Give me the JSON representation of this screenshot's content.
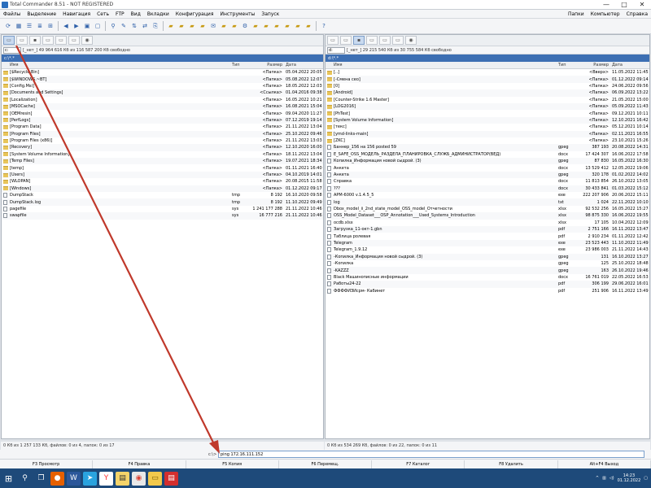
{
  "window": {
    "title": "Total Commander 8.51 - NOT REGISTERED",
    "controls": [
      "—",
      "□",
      "✕"
    ]
  },
  "menu": {
    "items": [
      "Файлы",
      "Выделение",
      "Навигация",
      "Сеть",
      "FTP",
      "Вид",
      "Вкладки",
      "Конфигурация",
      "Инструменты",
      "Запуск"
    ],
    "right": [
      "Папки",
      "Компьютер",
      "Справка"
    ]
  },
  "toolbar": {
    "icons": [
      "refresh-icon",
      "thumbnails-icon",
      "brief-icon",
      "full-icon",
      "tree-icon",
      "back-icon",
      "forward-icon",
      "pack-icon",
      "unpack-icon",
      "search-icon",
      "rename-icon",
      "ftp-icon",
      "sync-icon",
      "copy-names-icon",
      "folder-icon",
      "folder-icon",
      "folder-icon",
      "folder-icon",
      "notepad-icon",
      "folder-icon",
      "folder-icon",
      "settings-icon",
      "folder-icon",
      "folder-icon",
      "folder-icon",
      "folder-icon",
      "folder-icon",
      "folder-icon",
      "help-icon"
    ]
  },
  "left": {
    "drive": "c:",
    "free": "[_нет_]  49 964 616 Кб из 116 587 200 Кб свободно",
    "path": "c:\\*.*",
    "headers": {
      "name": "Имя",
      "ext": "Тип",
      "size": "Размер",
      "date": "Дата"
    },
    "rows": [
      {
        "name": "[$Recycle.Bin]",
        "ext": "",
        "size": "<Папка>",
        "date": "05.04.2022 20:05",
        "type": "folder"
      },
      {
        "name": "[$WINDOWS.~BT]",
        "ext": "",
        "size": "<Папка>",
        "date": "05.08.2022 12:07",
        "type": "folder"
      },
      {
        "name": "[Config.Msi]",
        "ext": "",
        "size": "<Папка>",
        "date": "18.05.2022 12:03",
        "type": "folder"
      },
      {
        "name": "[Documents and Settings]",
        "ext": "",
        "size": "<Ссылка>",
        "date": "01.04.2016 09:38",
        "type": "folder"
      },
      {
        "name": "[Localization]",
        "ext": "",
        "size": "<Папка>",
        "date": "16.05.2022 10:21",
        "type": "folder"
      },
      {
        "name": "[MSOCache]",
        "ext": "",
        "size": "<Папка>",
        "date": "16.08.2021 15:04",
        "type": "folder"
      },
      {
        "name": "[OEMresin]",
        "ext": "",
        "size": "<Папка>",
        "date": "09.04.2020 11:27",
        "type": "folder"
      },
      {
        "name": "[PerfLogs]",
        "ext": "",
        "size": "<Папка>",
        "date": "07.12.2019 19:14",
        "type": "folder"
      },
      {
        "name": "[Program Data]",
        "ext": "",
        "size": "<Папка>",
        "date": "21.11.2022 13:04",
        "type": "folder"
      },
      {
        "name": "[Program Files]",
        "ext": "",
        "size": "<Папка>",
        "date": "25.10.2022 09:46",
        "type": "folder"
      },
      {
        "name": "[Program Files (x86)]",
        "ext": "",
        "size": "<Папка>",
        "date": "21.11.2022 13:03",
        "type": "folder"
      },
      {
        "name": "[Recovery]",
        "ext": "",
        "size": "<Папка>",
        "date": "12.10.2020 16:00",
        "type": "folder"
      },
      {
        "name": "[System Volume Information]",
        "ext": "",
        "size": "<Папка>",
        "date": "18.11.2022 13:04",
        "type": "folder"
      },
      {
        "name": "[Temp Files]",
        "ext": "",
        "size": "<Папка>",
        "date": "19.07.2021 18:34",
        "type": "folder"
      },
      {
        "name": "[temp]",
        "ext": "",
        "size": "<Папка>",
        "date": "01.11.2021 16:40",
        "type": "folder"
      },
      {
        "name": "[Users]",
        "ext": "",
        "size": "<Папка>",
        "date": "04.10.2019 14:01",
        "type": "folder"
      },
      {
        "name": "[WLOPAN]",
        "ext": "",
        "size": "<Папка>",
        "date": "20.08.2015 11:58",
        "type": "folder"
      },
      {
        "name": "[Windows]",
        "ext": "",
        "size": "<Папка>",
        "date": "01.12.2022 09:17",
        "type": "folder"
      },
      {
        "name": "DumpStack",
        "ext": "tmp",
        "size": "8 192",
        "date": "16.10.2020 09:58",
        "type": "file"
      },
      {
        "name": "DumpStack.log",
        "ext": "tmp",
        "size": "8 192",
        "date": "11.10.2022 09:49",
        "type": "file"
      },
      {
        "name": "pagefile",
        "ext": "sys",
        "size": "1 241 177 288",
        "date": "21.11.2022 10:46",
        "type": "file"
      },
      {
        "name": "swapfile",
        "ext": "sys",
        "size": "16 777 216",
        "date": "21.11.2022 10:46",
        "type": "file"
      }
    ],
    "status": "0 Кб из 1 257 133 Кб, файлов: 0 из 4, папок: 0 из 17"
  },
  "right": {
    "drive": "d:",
    "free": "[_нет_]  29 215 540 Кб из 30 755 584 Кб свободно",
    "path": "d:\\*.*",
    "headers": {
      "name": "Имя",
      "ext": "Тип",
      "size": "Размер",
      "date": "Дата"
    },
    "rows": [
      {
        "name": "[..]",
        "ext": "",
        "size": "<Вверх>",
        "date": "11.05.2022 11:45",
        "type": "up"
      },
      {
        "name": "[-Смена сео]",
        "ext": "",
        "size": "<Папка>",
        "date": "01.12.2022 09:14",
        "type": "folder"
      },
      {
        "name": "[0]",
        "ext": "",
        "size": "<Папка>",
        "date": "24.06.2022 09:56",
        "type": "folder"
      },
      {
        "name": "[Android]",
        "ext": "",
        "size": "<Папка>",
        "date": "06.09.2022 13:22",
        "type": "folder"
      },
      {
        "name": "[Counter-Strike 1.6 Master]",
        "ext": "",
        "size": "<Папка>",
        "date": "21.05.2022 15:00",
        "type": "folder"
      },
      {
        "name": "[LOG2016]",
        "ext": "",
        "size": "<Папка>",
        "date": "05.09.2022 11:43",
        "type": "folder"
      },
      {
        "name": "[PhTest]",
        "ext": "",
        "size": "<Папка>",
        "date": "09.12.2021 10:11",
        "type": "folder"
      },
      {
        "name": "[System Volume Information]",
        "ext": "",
        "size": "<Папка>",
        "date": "12.10.2021 16:42",
        "type": "folder"
      },
      {
        "name": "[текс]",
        "ext": "",
        "size": "<Папка>",
        "date": "05.12.2021 10:14",
        "type": "folder"
      },
      {
        "name": "[ymd-links-main]",
        "ext": "",
        "size": "<Папка>",
        "date": "02.11.2021 16:55",
        "type": "folder"
      },
      {
        "name": "[ZKC]",
        "ext": "",
        "size": "<Папка>",
        "date": "23.10.2021 15:26",
        "type": "folder"
      },
      {
        "name": "Баннер_156 на 156 posted 59",
        "ext": "gpeg",
        "size": "387 193",
        "date": "20.08.2022 14:31",
        "type": "file"
      },
      {
        "name": "Е_SAFE_OSS_МОДЕЛЬ_РАЗДЕЛА_ПЛАНИРОВКА_СЛУЖБ_АДМИНИСТРАТОР(ВЕД)",
        "ext": "docx",
        "size": "17 424 307",
        "date": "16.06.2022 17:58",
        "type": "file"
      },
      {
        "name": "Копилка_Информация новой сыдрой. (3)",
        "ext": "gpeg",
        "size": "87 830",
        "date": "16.05.2022 16:30",
        "type": "file"
      },
      {
        "name": "Анкета",
        "ext": "docx",
        "size": "13 529 412",
        "date": "12.05.2022 19:06",
        "type": "file"
      },
      {
        "name": "Анкета",
        "ext": "gpeg",
        "size": "320 178",
        "date": "01.02.2022 14:02",
        "type": "file"
      },
      {
        "name": "Справка",
        "ext": "docx",
        "size": "11 813 854",
        "date": "26.10.2022 13:05",
        "type": "file"
      },
      {
        "name": "???",
        "ext": "docx",
        "size": "30 433 841",
        "date": "01.03.2022 15:12",
        "type": "file"
      },
      {
        "name": "АРМ-6000 v.1.4.5_5",
        "ext": "exe",
        "size": "222 207 906",
        "date": "20.06.2022 15:11",
        "type": "file"
      },
      {
        "name": "log",
        "ext": "txt",
        "size": "1 024",
        "date": "22.11.2022 10:10",
        "type": "file"
      },
      {
        "name": "Dbox_model_ii_2nd_state_model_OSS_model_Отчетности",
        "ext": "xlsx",
        "size": "92 532 256",
        "date": "16.05.2022 15:27",
        "type": "file"
      },
      {
        "name": "OSS_Model_Dataset___OSP_Annotation___Used_Systems_Introduction",
        "ext": "xlsx",
        "size": "98 875 330",
        "date": "16.06.2022 19:55",
        "type": "file"
      },
      {
        "name": "ocdb.xlsx",
        "ext": "xlsx",
        "size": "17 105",
        "date": "10.04.2022 12:09",
        "type": "file"
      },
      {
        "name": "Загрузка_11-окт-1.gbn",
        "ext": "pdf",
        "size": "2 751 166",
        "date": "16.11.2022 13:47",
        "type": "file"
      },
      {
        "name": "Таблица ролевая",
        "ext": "pdf",
        "size": "2 910 234",
        "date": "01.11.2022 12:42",
        "type": "file"
      },
      {
        "name": "Telegram",
        "ext": "exe",
        "size": "23 523 443",
        "date": "11.10.2022 11:49",
        "type": "file"
      },
      {
        "name": "Telegram_1.9.12",
        "ext": "exe",
        "size": "23 986 003",
        "date": "21.11.2022 14:43",
        "type": "file"
      },
      {
        "name": "-Копилка_Информация новой сыдрой. (3)",
        "ext": "gpeg",
        "size": "131",
        "date": "16.10.2022 13:27",
        "type": "file"
      },
      {
        "name": "-Копилка",
        "ext": "gpeg",
        "size": "125",
        "date": "25.10.2022 18:48",
        "type": "file"
      },
      {
        "name": "-KAZZZ",
        "ext": "gpeg",
        "size": "163",
        "date": "26.10.2022 19:46",
        "type": "file"
      },
      {
        "name": "Black Машинописные информации",
        "ext": "docx",
        "size": "16 761 019",
        "date": "22.05.2022 16:53",
        "type": "file"
      },
      {
        "name": "Работы24-22",
        "ext": "pdf",
        "size": "306 199",
        "date": "29.06.2022 16:01",
        "type": "file"
      },
      {
        "name": "ФФФФИЗИсрм- Кабинет",
        "ext": "pdf",
        "size": "251 906",
        "date": "16.11.2022 13:49",
        "type": "file"
      }
    ],
    "status": "0 Кб из 534 269 Кб, файлов: 0 из 22, папок: 0 из 11"
  },
  "cmdline": {
    "label": "c:\\>",
    "value": "ping 172.16.111.152"
  },
  "funckeys": [
    "F3 Просмотр",
    "F4 Правка",
    "F5 Копия",
    "F6 Перемещ.",
    "F7 Каталог",
    "F8 Удалить",
    "Alt+F4 Выход"
  ],
  "taskbar": {
    "icons": [
      "windows-start-icon",
      "search-icon",
      "task-view-icon",
      "firefox-icon",
      "word-icon",
      "telegram-icon",
      "yandex-icon",
      "total-commander-icon",
      "chrome-icon",
      "file-explorer-icon",
      "pdf-icon"
    ],
    "time": "14:23",
    "date": "01.12.2022"
  },
  "annotation": {
    "color": "#c0392b"
  }
}
